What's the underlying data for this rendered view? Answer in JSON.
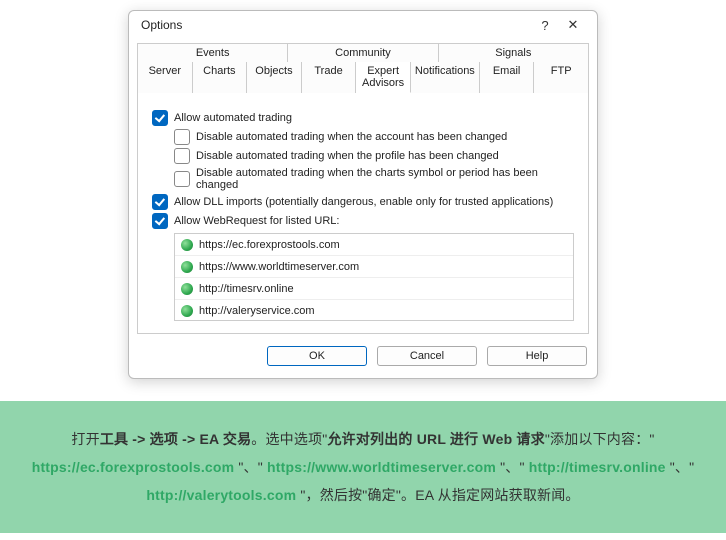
{
  "dialog": {
    "title": "Options",
    "help_glyph": "?",
    "close_glyph": "✕",
    "tab_rows": [
      [
        {
          "label": "Events",
          "span": 2
        },
        {
          "label": "Community",
          "span": 2
        },
        {
          "label": "Signals",
          "span": 2
        }
      ],
      [
        {
          "label": "Server"
        },
        {
          "label": "Charts"
        },
        {
          "label": "Objects"
        },
        {
          "label": "Trade"
        },
        {
          "label": "Expert Advisors",
          "active": true
        },
        {
          "label": "Notifications"
        },
        {
          "label": "Email"
        },
        {
          "label": "FTP"
        }
      ]
    ],
    "options": [
      {
        "label": "Allow automated trading",
        "checked": true,
        "sub": false
      },
      {
        "label": "Disable automated trading when the account has been changed",
        "checked": false,
        "sub": true
      },
      {
        "label": "Disable automated trading when the profile has been changed",
        "checked": false,
        "sub": true
      },
      {
        "label": "Disable automated trading when the charts symbol or period has been changed",
        "checked": false,
        "sub": true
      },
      {
        "label": "Allow DLL imports (potentially dangerous, enable only for trusted applications)",
        "checked": true,
        "sub": false
      },
      {
        "label": "Allow WebRequest for listed URL:",
        "checked": true,
        "sub": false
      }
    ],
    "urls": [
      "https://ec.forexprostools.com",
      "https://www.worldtimeserver.com",
      "http://timesrv.online",
      "http://valeryservice.com"
    ],
    "buttons": {
      "ok": "OK",
      "cancel": "Cancel",
      "help": "Help"
    }
  },
  "info": {
    "t1": "打开",
    "b1": "工具 -> 选项 -> EA 交易",
    "t2": "。选中选项\"",
    "b2": "允许对列出的 URL 进行 Web 请求",
    "t3": "\"添加以下内容：\" ",
    "u1": "https://ec.forexprostools.com",
    "t4": " \"、\" ",
    "u2": "https://www.worldtimeserver.com",
    "t5": " \"、\" ",
    "u3": "http://timesrv.online",
    "t6": " \"、\" ",
    "u4": "http://valerytools.com",
    "t7": " \"，然后按\"确定\"。EA 从指定网站获取新闻。"
  }
}
